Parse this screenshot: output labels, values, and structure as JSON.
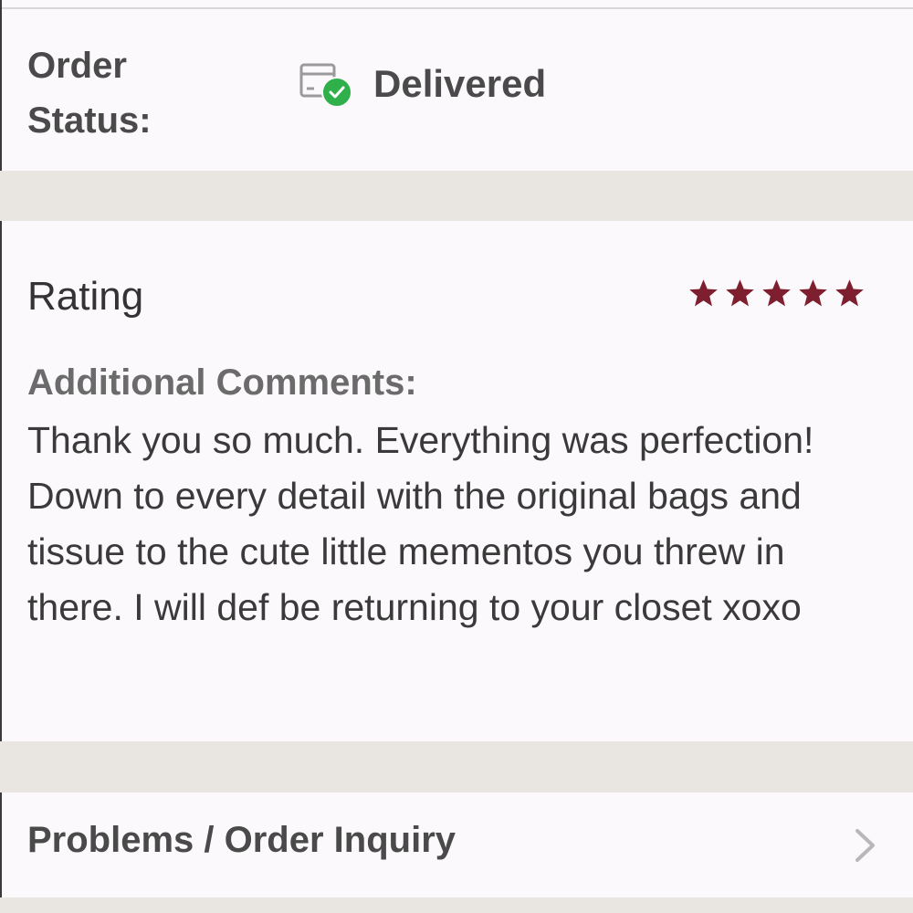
{
  "order_status": {
    "label": "Order Status:",
    "value": "Delivered",
    "icon": "package-delivered-icon",
    "check_color": "#2fb04b"
  },
  "rating": {
    "title": "Rating",
    "stars": 5,
    "max_stars": 5,
    "star_color": "#7d1f2e"
  },
  "comments": {
    "label": "Additional Comments:",
    "text": "Thank you so much. Everything was perfection! Down to every detail with the original bags and tissue to the cute little mementos you threw in there. I will def be returning to your closet xoxo"
  },
  "problems": {
    "label": "Problems / Order Inquiry",
    "icon": "chevron-right-icon"
  }
}
